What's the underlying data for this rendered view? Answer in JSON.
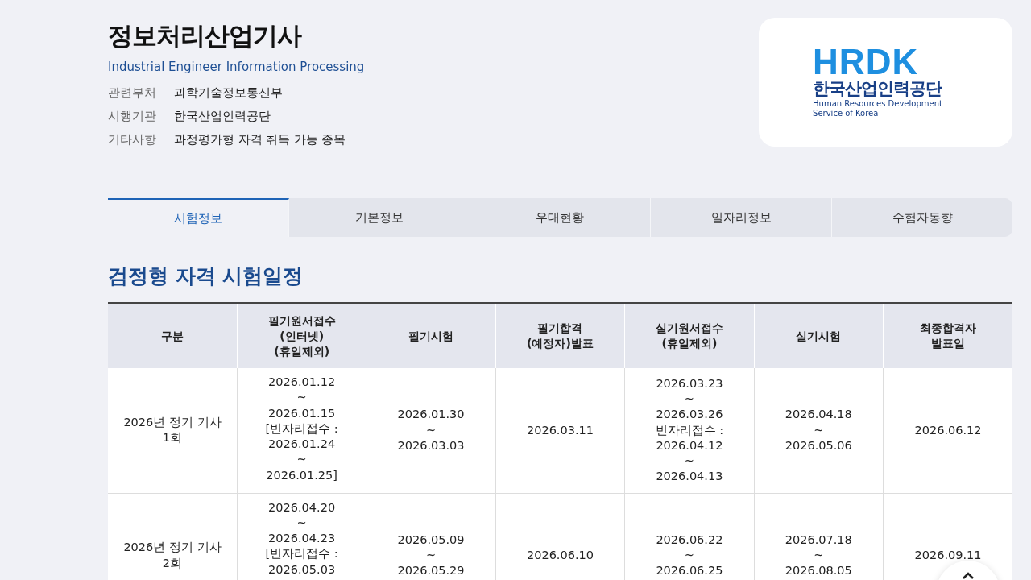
{
  "header": {
    "title": "정보처리산업기사",
    "subtitle": "Industrial Engineer Information Processing",
    "info": [
      {
        "label": "관련부처",
        "value": "과학기술정보통신부"
      },
      {
        "label": "시행기관",
        "value": "한국산업인력공단"
      },
      {
        "label": "기타사항",
        "value": "과정평가형 자격 취득 가능 종목"
      }
    ]
  },
  "logo": {
    "mark": "HRDK",
    "name": "한국산업인력공단",
    "english": [
      "Human Resources Development",
      "Service of Korea"
    ]
  },
  "tabs": [
    {
      "label": "시험정보",
      "selected": true
    },
    {
      "label": "기본정보",
      "selected": false
    },
    {
      "label": "우대현황",
      "selected": false
    },
    {
      "label": "일자리정보",
      "selected": false
    },
    {
      "label": "수험자동향",
      "selected": false
    }
  ],
  "section_title": "검정형 자격 시험일정",
  "table": {
    "columns": [
      "구분",
      "필기원서접수\n(인터넷)\n(휴일제외)",
      "필기시험",
      "필기합격\n(예정자)발표",
      "실기원서접수\n(휴일제외)",
      "실기시험",
      "최종합격자\n발표일"
    ],
    "rows": [
      [
        "2026년 정기 기사\n1회",
        "2026.01.12\n~\n2026.01.15\n[빈자리접수 :\n2026.01.24\n~\n2026.01.25]",
        "2026.01.30\n~\n2026.03.03",
        "2026.03.11",
        "2026.03.23\n~\n2026.03.26\n빈자리접수 :\n2026.04.12\n~\n2026.04.13",
        "2026.04.18\n~\n2026.05.06",
        "2026.06.12"
      ],
      [
        "2026년 정기 기사\n2회",
        "2026.04.20\n~\n2026.04.23\n[빈자리접수 :\n2026.05.03",
        "2026.05.09\n~\n2026.05.29",
        "2026.06.10",
        "2026.06.22\n~\n2026.06.25",
        "2026.07.18\n~\n2026.08.05",
        "2026.09.11"
      ]
    ]
  }
}
